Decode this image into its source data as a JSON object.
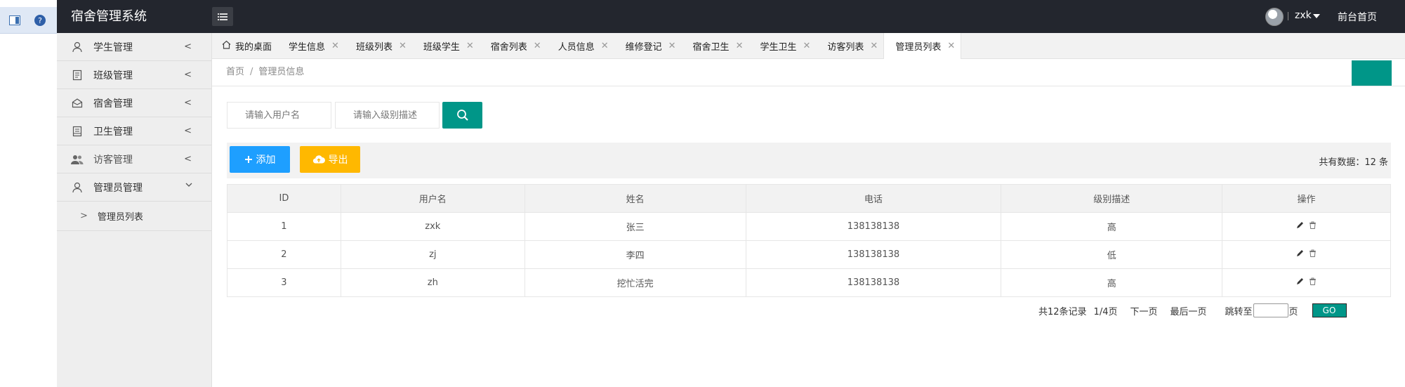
{
  "app": {
    "title": "宿舍管理系统"
  },
  "header": {
    "username": "zxk",
    "home_link": "前台首页"
  },
  "sidebar": {
    "items": [
      {
        "label": "学生管理"
      },
      {
        "label": "班级管理"
      },
      {
        "label": "宿舍管理"
      },
      {
        "label": "卫生管理"
      },
      {
        "label": "访客管理"
      },
      {
        "label": "管理员管理"
      }
    ],
    "sub_items": [
      {
        "label": "管理员列表"
      }
    ]
  },
  "tabs": [
    {
      "label": "我的桌面"
    },
    {
      "label": "学生信息"
    },
    {
      "label": "班级列表"
    },
    {
      "label": "班级学生"
    },
    {
      "label": "宿舍列表"
    },
    {
      "label": "人员信息"
    },
    {
      "label": "维修登记"
    },
    {
      "label": "宿舍卫生"
    },
    {
      "label": "学生卫生"
    },
    {
      "label": "访客列表"
    },
    {
      "label": "管理员列表"
    }
  ],
  "breadcrumb": {
    "home": "首页",
    "separator": "/",
    "current": "管理员信息"
  },
  "search": {
    "username_placeholder": "请输入用户名",
    "level_placeholder": "请输入级别描述"
  },
  "toolbar": {
    "add_label": "添加",
    "export_label": "导出",
    "total_label": "共有数据：12 条"
  },
  "table": {
    "headers": [
      "ID",
      "用户名",
      "姓名",
      "电话",
      "级别描述",
      "操作"
    ],
    "rows": [
      {
        "id": "1",
        "username": "zxk",
        "name": "张三",
        "phone": "138138138",
        "level": "高"
      },
      {
        "id": "2",
        "username": "zj",
        "name": "李四",
        "phone": "138138138",
        "level": "低"
      },
      {
        "id": "3",
        "username": "zh",
        "name": "挖忙活完",
        "phone": "138138138",
        "level": "高"
      }
    ]
  },
  "pager": {
    "records": "共12条记录",
    "pages": "1/4页",
    "next": "下一页",
    "last": "最后一页",
    "jump_prefix": "跳转至",
    "jump_suffix": "页",
    "go": "GO"
  },
  "colors": {
    "topbar": "#23262e",
    "sidebar": "#eeeeee",
    "primary_teal": "#009688",
    "add_blue": "#1e9fff",
    "export_orange": "#ffb800"
  },
  "icons": {
    "sidebar": [
      "user-icon",
      "class-icon",
      "dorm-icon",
      "hygiene-icon",
      "visitor-icon",
      "admin-icon"
    ],
    "actions": [
      "edit-icon",
      "delete-icon"
    ]
  }
}
